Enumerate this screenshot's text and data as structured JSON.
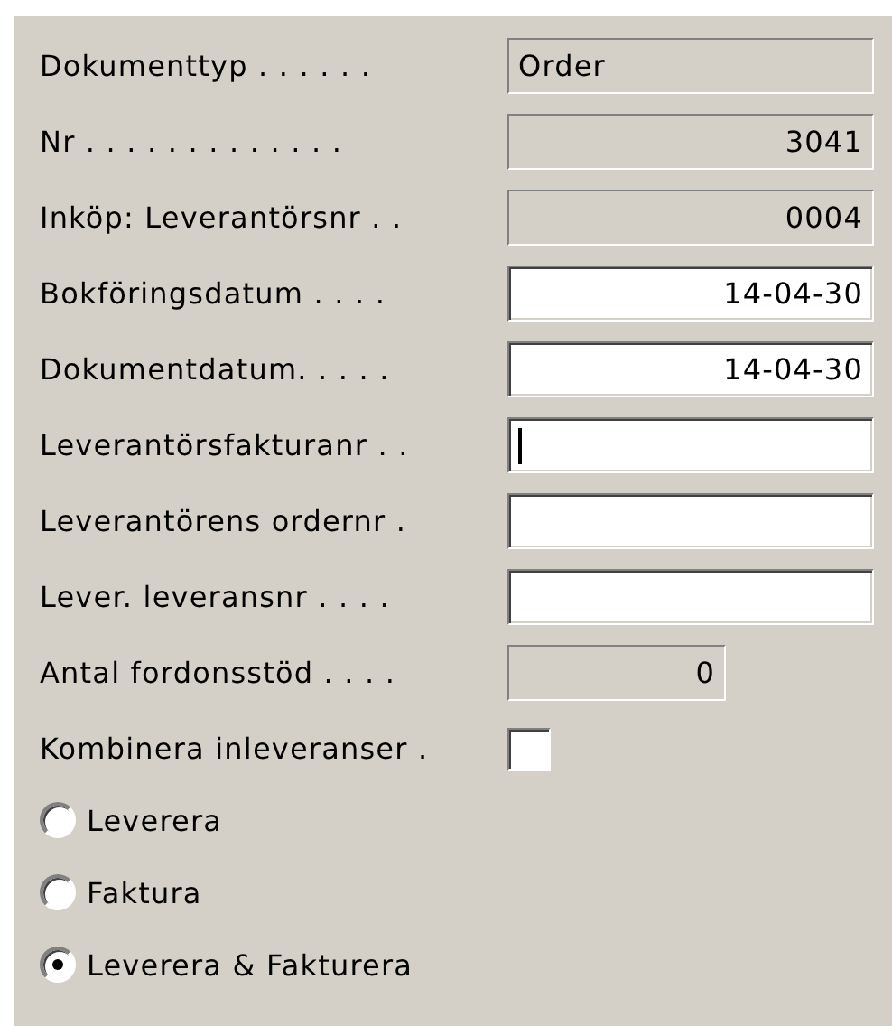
{
  "form": {
    "groups": [
      {
        "rows": [
          {
            "kind": "text",
            "label": "Dokumenttyp . . . . . .",
            "value": "Order",
            "editable": false,
            "focused": false
          },
          {
            "kind": "number",
            "label": "Nr . . . . . . . . . . . . .",
            "value": "3041",
            "editable": false,
            "focused": false
          },
          {
            "kind": "number",
            "label": "Inköp: Leverantörsnr . .",
            "value": "0004",
            "editable": false,
            "focused": false
          }
        ]
      },
      {
        "rows": [
          {
            "kind": "number",
            "label": "Bokföringsdatum . . . .",
            "value": "14-04-30",
            "editable": true,
            "focused": false
          },
          {
            "kind": "number",
            "label": "Dokumentdatum. . . . .",
            "value": "14-04-30",
            "editable": true,
            "focused": false
          },
          {
            "kind": "text",
            "label": "Leverantörsfakturanr . .",
            "editable": true,
            "focused": true
          },
          {
            "kind": "text",
            "label": "Leverantörens ordernr  .",
            "editable": true,
            "focused": false
          },
          {
            "kind": "text",
            "label": "Lever. leveransnr . . . .",
            "editable": true,
            "focused": false
          }
        ]
      },
      {
        "rows": [
          {
            "kind": "counter",
            "label": "Antal fordonsstöd . . . .",
            "value": "0",
            "editable": false,
            "focused": false
          },
          {
            "kind": "checkbox",
            "label": "Kombinera inleveranser  .",
            "checked": false
          }
        ]
      }
    ]
  },
  "options": [
    {
      "label": "Leverera",
      "selected": false
    },
    {
      "label": "Faktura",
      "selected": false
    },
    {
      "label": "Leverera & Fakturera",
      "selected": true
    }
  ]
}
